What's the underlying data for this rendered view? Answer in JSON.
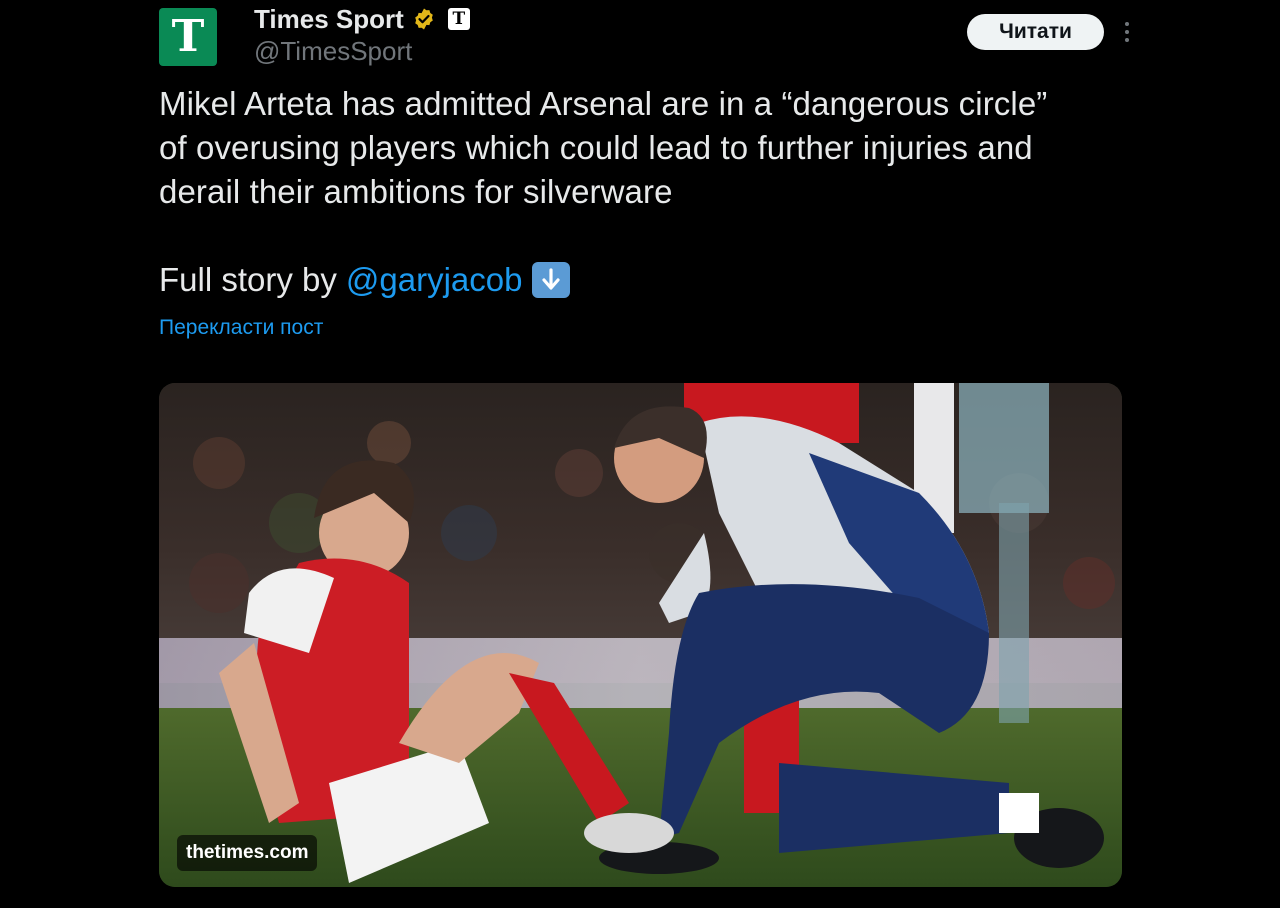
{
  "author": {
    "display_name": "Times Sport",
    "handle": "@TimesSport",
    "avatar_letter": "T",
    "affiliate_letter": "T",
    "avatar_color": "#0a8a55",
    "verified_color": "#e2b719"
  },
  "follow_button": {
    "label": "Читати"
  },
  "tweet": {
    "lines": [
      "Mikel Arteta has admitted Arsenal are in a “dangerous circle”",
      "of overusing players which could lead to further injuries and",
      "derail their ambitions for silverware"
    ],
    "story_prefix": "Full story by",
    "mention": "@garyjacob",
    "story_icon": "down-arrow-emoji",
    "translate_label": "Перекласти пост"
  },
  "media": {
    "watermark": "thetimes.com",
    "description_icon": "football-injury-photo"
  },
  "colors": {
    "background": "#000000",
    "text": "#e7e9ea",
    "secondary": "#71767b",
    "link": "#1d9bf0"
  }
}
